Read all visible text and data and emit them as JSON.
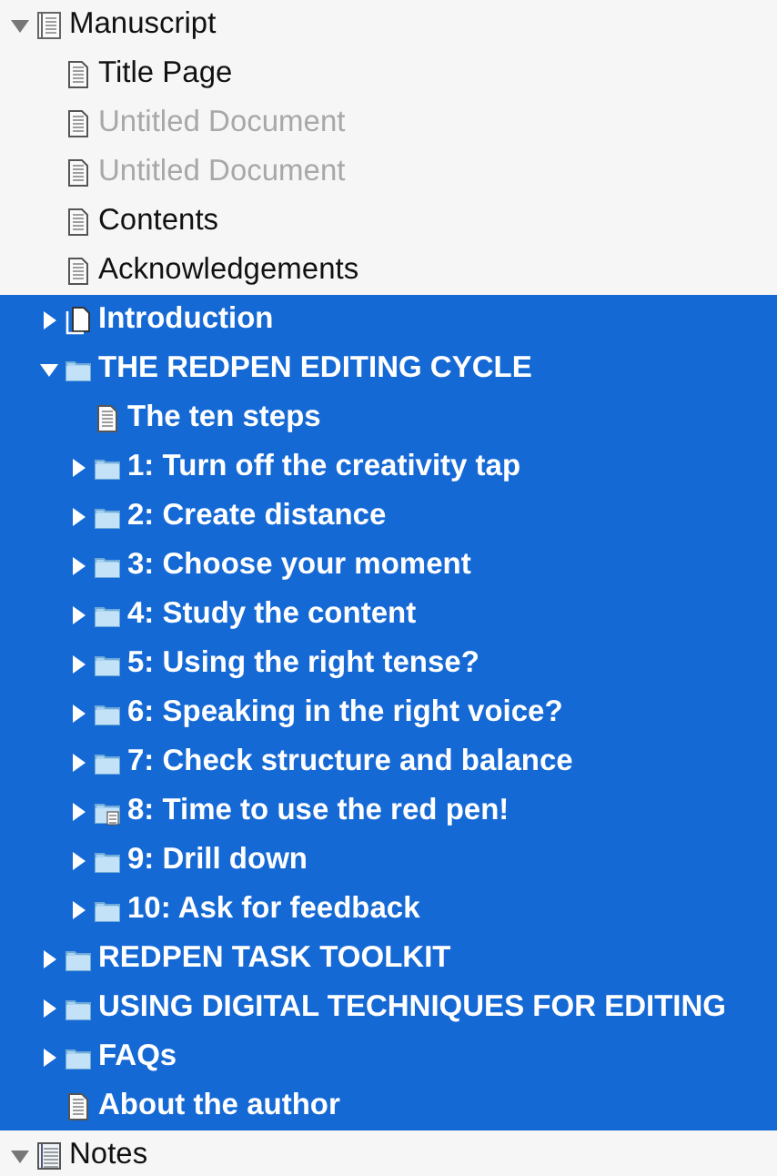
{
  "outline": [
    {
      "title": "Manuscript",
      "kind": "draft",
      "expanded": true,
      "selected": false,
      "children": [
        {
          "title": "Title Page",
          "kind": "text",
          "selected": false,
          "empty": false
        },
        {
          "title": "Untitled Document",
          "kind": "text",
          "selected": false,
          "empty": true
        },
        {
          "title": "Untitled Document",
          "kind": "text",
          "selected": false,
          "empty": true
        },
        {
          "title": "Contents",
          "kind": "text",
          "selected": false,
          "empty": false
        },
        {
          "title": "Acknowledgements",
          "kind": "text",
          "selected": false,
          "empty": false
        },
        {
          "title": "Introduction",
          "kind": "pages",
          "expanded": false,
          "selected": true
        },
        {
          "title": "THE REDPEN EDITING CYCLE",
          "kind": "folder",
          "expanded": true,
          "selected": true,
          "children": [
            {
              "title": "The ten steps",
              "kind": "text",
              "selected": true
            },
            {
              "title": "1: Turn off the creativity tap",
              "kind": "folder",
              "expanded": false,
              "selected": true
            },
            {
              "title": "2: Create distance",
              "kind": "folder",
              "expanded": false,
              "selected": true
            },
            {
              "title": "3: Choose your moment",
              "kind": "folder",
              "expanded": false,
              "selected": true
            },
            {
              "title": "4: Study the content",
              "kind": "folder",
              "expanded": false,
              "selected": true
            },
            {
              "title": "5: Using the right tense?",
              "kind": "folder",
              "expanded": false,
              "selected": true
            },
            {
              "title": "6: Speaking in the right voice?",
              "kind": "folder",
              "expanded": false,
              "selected": true
            },
            {
              "title": "7: Check structure and balance",
              "kind": "folder",
              "expanded": false,
              "selected": true
            },
            {
              "title": "8: Time to use the red pen!",
              "kind": "folder-text",
              "expanded": false,
              "selected": true
            },
            {
              "title": "9: Drill down",
              "kind": "folder",
              "expanded": false,
              "selected": true
            },
            {
              "title": "10: Ask for feedback",
              "kind": "folder",
              "expanded": false,
              "selected": true
            }
          ]
        },
        {
          "title": "REDPEN TASK TOOLKIT",
          "kind": "folder",
          "expanded": false,
          "selected": true
        },
        {
          "title": "USING DIGITAL TECHNIQUES FOR EDITING",
          "kind": "folder",
          "expanded": false,
          "selected": true
        },
        {
          "title": "FAQs",
          "kind": "folder",
          "expanded": false,
          "selected": true
        },
        {
          "title": "About the author",
          "kind": "text",
          "selected": true
        }
      ]
    },
    {
      "title": "Notes",
      "kind": "notebook",
      "expanded": true,
      "selected": false
    }
  ]
}
